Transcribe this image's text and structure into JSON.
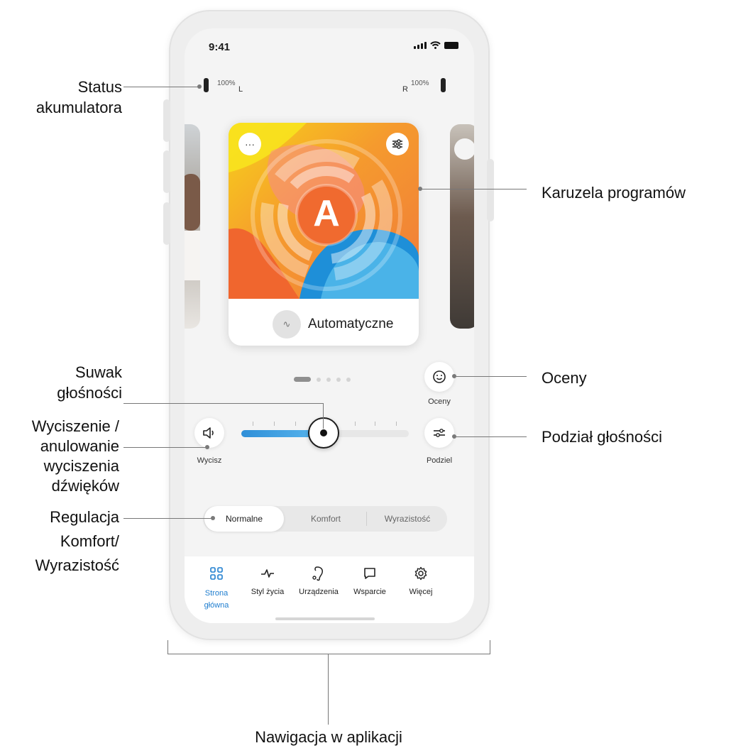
{
  "status_bar": {
    "time": "9:41"
  },
  "battery": {
    "left_pct": "100%",
    "left_side": "L",
    "right_pct": "100%",
    "right_side": "R"
  },
  "carousel": {
    "program_letter": "A",
    "program_name": "Automatyczne",
    "more_icon": "more-icon",
    "settings_icon": "sliders-icon",
    "page_count": 5,
    "active_page": 1
  },
  "controls": {
    "ratings_label": "Oceny",
    "mute_label": "Wycisz",
    "split_label": "Podziel",
    "volume_level": 0.49
  },
  "sound_mode": {
    "options": [
      "Normalne",
      "Komfort",
      "Wyrazistość"
    ],
    "selected": "Normalne"
  },
  "nav": {
    "items": [
      {
        "label": "Strona\ngłówna",
        "icon": "grid-icon",
        "active": true
      },
      {
        "label": "Styl życia",
        "icon": "pulse-icon",
        "active": false
      },
      {
        "label": "Urządzenia",
        "icon": "hearing-aid-icon",
        "active": false
      },
      {
        "label": "Wsparcie",
        "icon": "chat-icon",
        "active": false
      },
      {
        "label": "Więcej",
        "icon": "gear-icon",
        "active": false
      }
    ]
  },
  "annotations": {
    "battery_status": "Status\nakumulatora",
    "program_carousel": "Karuzela programów",
    "ratings": "Oceny",
    "volume_slider": "Suwak\ngłośności",
    "mute": "Wyciszenie /\nanulowanie\nwyciszenia\ndźwięków",
    "volume_split": "Podział głośności",
    "comfort_clarity": "Regulacja\nKomfort/\nWyrazistość",
    "app_navigation": "Nawigacja w aplikacji"
  },
  "colors": {
    "accent_blue": "#1f7ecf",
    "slider_fill": "#3a9de0",
    "card_orange": "#f28b3a",
    "card_yellow": "#f6c21c"
  }
}
